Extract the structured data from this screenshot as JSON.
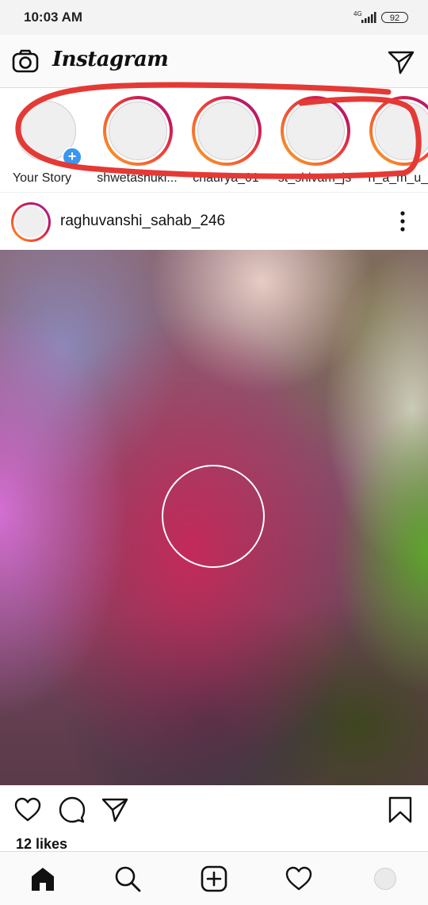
{
  "status_bar": {
    "time": "10:03 AM",
    "network": "4G",
    "battery": "92"
  },
  "header": {
    "logo": "Instagram"
  },
  "stories": [
    {
      "label": "Your Story",
      "own": true
    },
    {
      "label": "shwetashukl..."
    },
    {
      "label": "chaurya_01"
    },
    {
      "label": "st_shivam_js"
    },
    {
      "label": "h_a_m_u_..."
    }
  ],
  "post": {
    "username": "raghuvanshi_sahab_246",
    "likes": "12 likes"
  },
  "colors": {
    "annotation": "#e53935",
    "accent": "#3897f0"
  },
  "icons": [
    "camera-icon",
    "direct-message-icon",
    "add-story-icon",
    "more-options-icon",
    "play-circle-icon",
    "like-icon",
    "comment-icon",
    "share-icon",
    "bookmark-icon",
    "home-icon",
    "search-icon",
    "new-post-icon",
    "activity-icon",
    "profile-icon"
  ]
}
